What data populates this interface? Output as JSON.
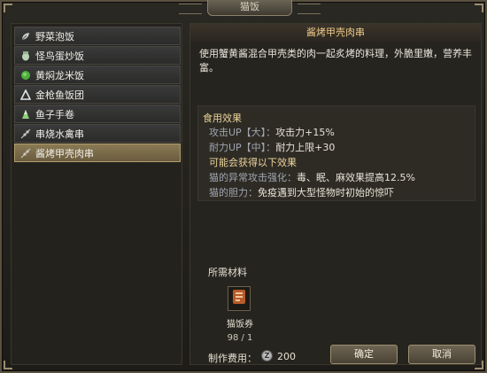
{
  "window": {
    "title": "猫饭"
  },
  "food_list": [
    {
      "label": "野菜泡饭",
      "icon": "leaf-icon",
      "icon_color": "#c9d3c7",
      "selected": false
    },
    {
      "label": "怪鸟蛋炒饭",
      "icon": "egg-icon",
      "icon_color": "#b9d4b4",
      "selected": false
    },
    {
      "label": "黄焖龙米饭",
      "icon": "rice-ball-icon",
      "icon_color": "#4caf3c",
      "selected": false
    },
    {
      "label": "金枪鱼饭团",
      "icon": "onigiri-icon",
      "icon_color": "#dfe6e9",
      "selected": false
    },
    {
      "label": "鱼子手卷",
      "icon": "hand-roll-icon",
      "icon_color": "#8fcf7a",
      "selected": false
    },
    {
      "label": "串烧水禽串",
      "icon": "skewer-icon",
      "icon_color": "#c8c6c0",
      "selected": false
    },
    {
      "label": "酱烤甲壳肉串",
      "icon": "skewer-icon",
      "icon_color": "#c8c6c0",
      "selected": true
    }
  ],
  "detail": {
    "title": "酱烤甲壳肉串",
    "description": "使用蟹黄酱混合甲壳类的肉一起炙烤的料理，外脆里嫩，营养丰富。",
    "effects_heading": "食用效果",
    "effects": [
      {
        "key": "攻击UP【大】：",
        "value": "攻击力+15%"
      },
      {
        "key": "耐力UP【中】：",
        "value": "耐力上限+30"
      }
    ],
    "possible_heading": "可能会获得以下效果",
    "possible_effects": [
      {
        "key": "猫的异常攻击强化：",
        "value": "毒、眠、麻效果提高12.5%"
      },
      {
        "key": "猫的胆力：",
        "value": "免疫遇到大型怪物时初始的惊吓"
      }
    ],
    "materials_heading": "所需材料",
    "material": {
      "name": "猫饭券",
      "count": "98 / 1",
      "icon": "ticket-icon",
      "icon_color": "#b85a2a"
    },
    "cost_label": "制作费用：",
    "cost_coin": "Z",
    "cost_value": "200"
  },
  "buttons": {
    "confirm": "确定",
    "cancel": "取消"
  },
  "colors": {
    "accent_gold": "#ecd49a",
    "title_orange": "#f0c98a",
    "selected_bg": "#7a6b4a"
  }
}
